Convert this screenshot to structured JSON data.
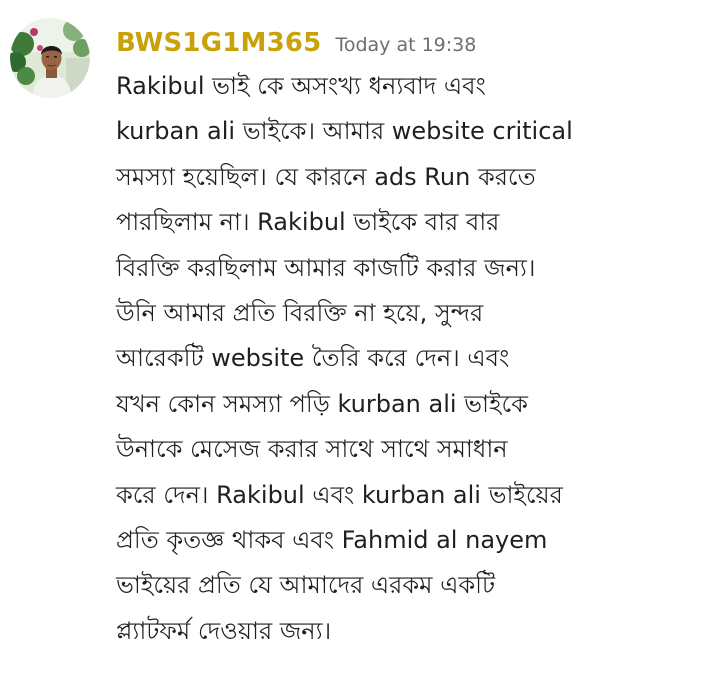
{
  "message": {
    "username": "BWS1G1M365",
    "timestamp": "Today at 19:38",
    "avatar_icon": "user-avatar-photo",
    "username_color": "#c9a20a",
    "lines": [
      "Rakibul ভাই কে অসংখ্য ধন্যবাদ এবং",
      "kurban ali ভাইকে। আমার website critical",
      "সমস্যা হয়েছিল। যে কারনে ads Run করতে",
      "পারছিলাম না। Rakibul ভাইকে বার বার",
      "বিরক্তি করছিলাম আমার কাজটি করার জন্য।",
      "উনি আমার প্রতি বিরক্তি না হয়ে, সুন্দর",
      "আরেকটি website  তৈরি করে দেন। এবং",
      "যখন কোন সমস্যা পড়ি kurban ali ভাইকে",
      "উনাকে মেসেজ করার সাথে সাথে সমাধান",
      "করে দেন।  Rakibul এবং kurban ali ভাইয়ের",
      "প্রতি কৃতজ্ঞ থাকব এবং Fahmid al nayem",
      "ভাইয়ের প্রতি যে আমাদের এরকম একটি",
      "প্ল্যাটফর্ম দেওয়ার জন্য।"
    ]
  }
}
